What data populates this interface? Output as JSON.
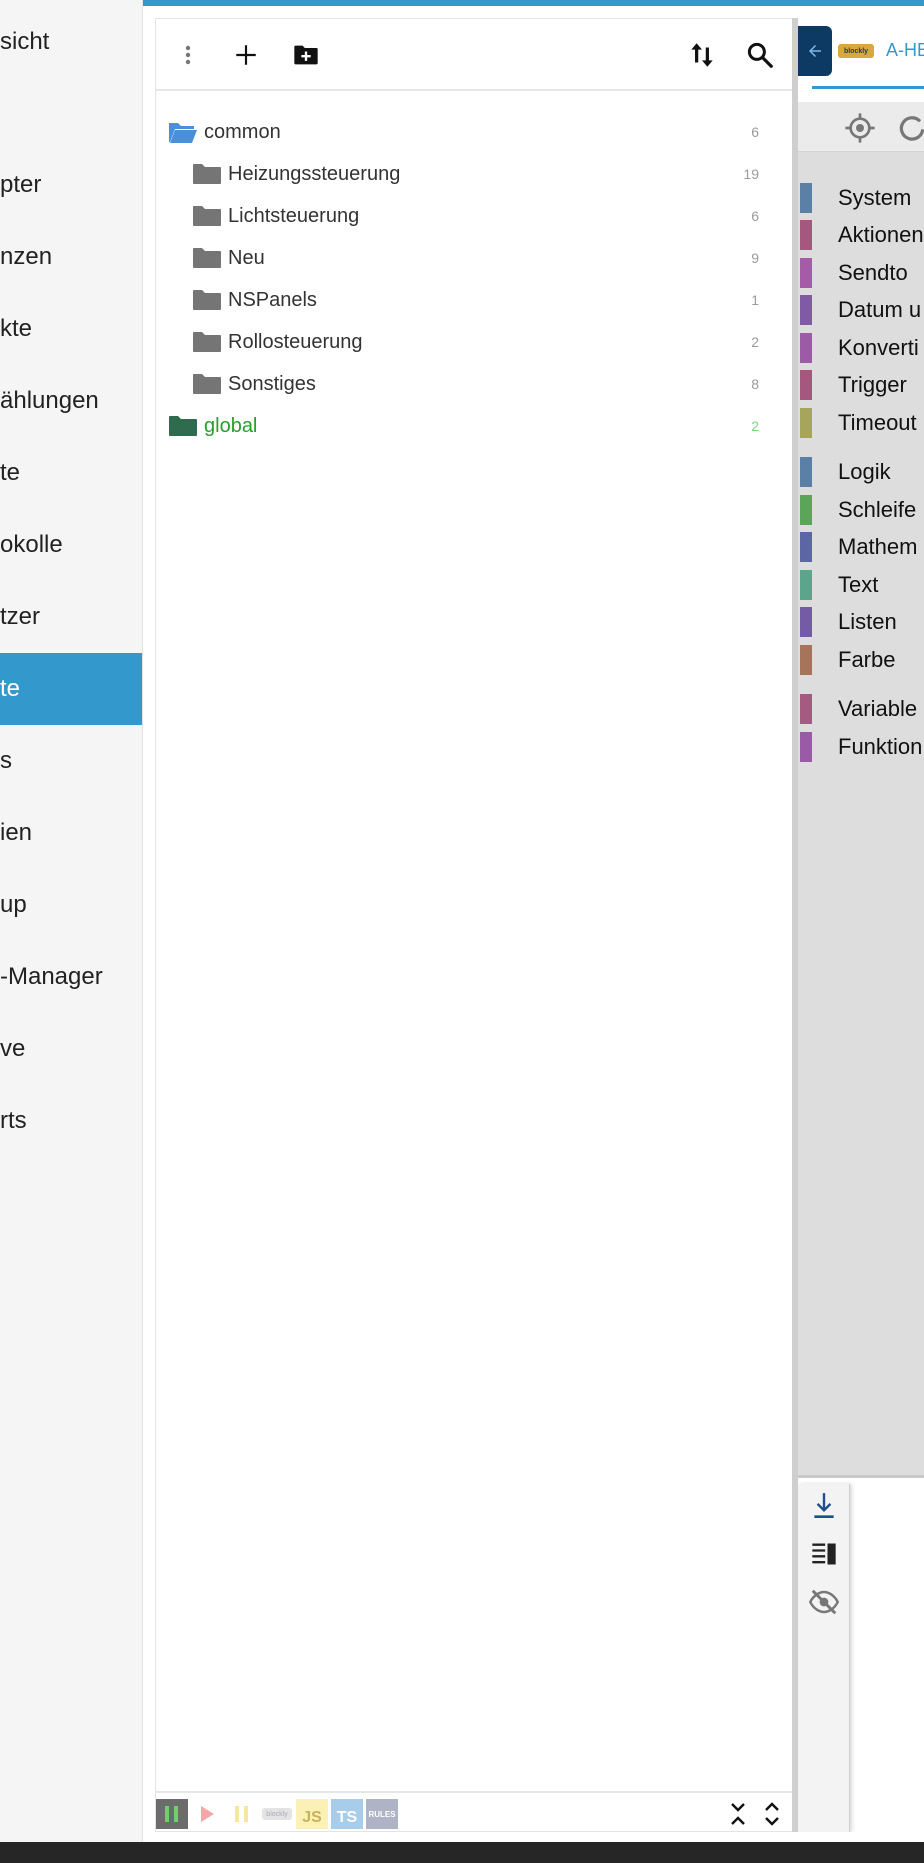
{
  "left_menu": {
    "items": [
      {
        "label": "sicht",
        "active": false
      },
      {
        "label": "pter",
        "active": false
      },
      {
        "label": "nzen",
        "active": false
      },
      {
        "label": "kte",
        "active": false
      },
      {
        "label": "ählungen",
        "active": false
      },
      {
        "label": "te",
        "active": false
      },
      {
        "label": "okolle",
        "active": false
      },
      {
        "label": "tzer",
        "active": false
      },
      {
        "label": "te",
        "active": true
      },
      {
        "label": "s",
        "active": false
      },
      {
        "label": "ien",
        "active": false
      },
      {
        "label": "up",
        "active": false
      },
      {
        "label": "-Manager",
        "active": false
      },
      {
        "label": "ve",
        "active": false
      },
      {
        "label": "rts",
        "active": false
      }
    ]
  },
  "tree_toolbar": {
    "menu_icon": "more-vert-icon",
    "add_icon": "plus-icon",
    "add_folder_icon": "create-folder-icon",
    "sort_icon": "sort-arrows-icon",
    "search_icon": "search-icon"
  },
  "tree": {
    "folders": [
      {
        "name": "common",
        "count": "6",
        "level": 0,
        "open": true
      },
      {
        "name": "Heizungssteuerung",
        "count": "19",
        "level": 1
      },
      {
        "name": "Lichtsteuerung",
        "count": "6",
        "level": 1
      },
      {
        "name": "Neu",
        "count": "9",
        "level": 1
      },
      {
        "name": "NSPanels",
        "count": "1",
        "level": 1
      },
      {
        "name": "Rollosteuerung",
        "count": "2",
        "level": 1
      },
      {
        "name": "Sonstiges",
        "count": "8",
        "level": 1
      },
      {
        "name": "global",
        "count": "2",
        "level": 0,
        "global": true
      }
    ]
  },
  "tree_footer": {
    "badges": {
      "js": "JS",
      "ts": "TS",
      "rules": "RULES",
      "blockly": "blockly"
    }
  },
  "editor": {
    "tab_title": "A-HE",
    "tab_logo": "blockly",
    "categories": [
      {
        "name": "System",
        "color": "#5b80a5"
      },
      {
        "name": "Aktionen",
        "color": "#a5577e"
      },
      {
        "name": "Sendto",
        "color": "#a55ba5"
      },
      {
        "name": "Datum u",
        "color": "#805ba5"
      },
      {
        "name": "Konverti",
        "color": "#9c5ba5"
      },
      {
        "name": "Trigger",
        "color": "#a5577e"
      },
      {
        "name": "Timeout",
        "color": "#a5a55b"
      },
      {
        "name": "Logik",
        "color": "#5b80a5"
      },
      {
        "name": "Schleife",
        "color": "#5ba55b"
      },
      {
        "name": "Mathem",
        "color": "#5b67a5"
      },
      {
        "name": "Text",
        "color": "#5ba58c"
      },
      {
        "name": "Listen",
        "color": "#745ba5"
      },
      {
        "name": "Farbe",
        "color": "#a5745b"
      },
      {
        "name": "Variable",
        "color": "#a55b80"
      },
      {
        "name": "Funktion",
        "color": "#995ba5"
      }
    ]
  },
  "colors": {
    "accent": "#3399cc",
    "folder_open": "#4a90d9",
    "folder": "#757575",
    "global_folder": "#2e6b4f",
    "global_text": "#26a02a"
  }
}
